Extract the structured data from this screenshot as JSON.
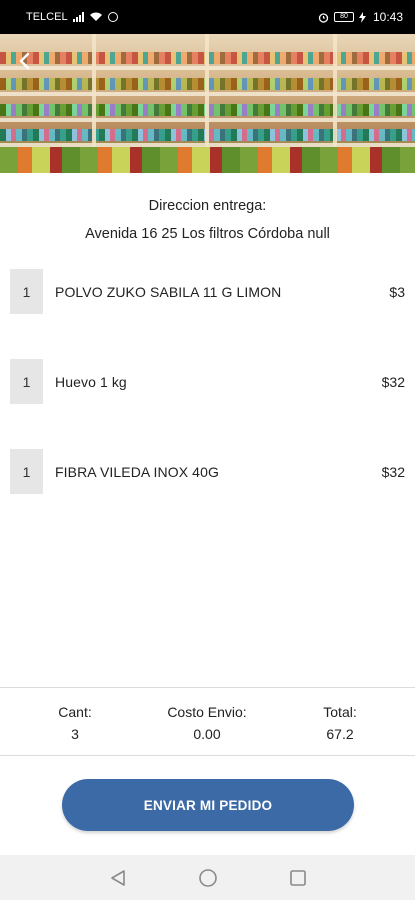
{
  "status_bar": {
    "carrier": "TELCEL",
    "time": "10:43",
    "battery": "80",
    "icons": [
      "signal-icon",
      "wifi-icon",
      "notification-icon",
      "alarm-icon",
      "battery-icon",
      "charging-icon"
    ]
  },
  "header": {
    "back_icon": "chevron-left-icon"
  },
  "delivery": {
    "label": "Direccion entrega:",
    "address": "Avenida 16 25 Los filtros Córdoba null"
  },
  "items": [
    {
      "qty": "1",
      "name": "POLVO ZUKO SABILA 11 G LIMON",
      "price": "$3"
    },
    {
      "qty": "1",
      "name": "Huevo 1 kg",
      "price": "$32"
    },
    {
      "qty": "1",
      "name": "FIBRA VILEDA INOX 40G",
      "price": "$32"
    }
  ],
  "summary": {
    "qty_label": "Cant:",
    "qty_value": "3",
    "shipping_label": "Costo Envio:",
    "shipping_value": "0.00",
    "total_label": "Total:",
    "total_value": "67.2"
  },
  "actions": {
    "submit_label": "ENVIAR MI PEDIDO"
  },
  "nav": {
    "icons": [
      "back-triangle-icon",
      "home-circle-icon",
      "recents-square-icon"
    ]
  },
  "colors": {
    "primary_button": "#3c6aa6",
    "qty_box": "#e6e6e6",
    "status_bar": "#000000"
  }
}
